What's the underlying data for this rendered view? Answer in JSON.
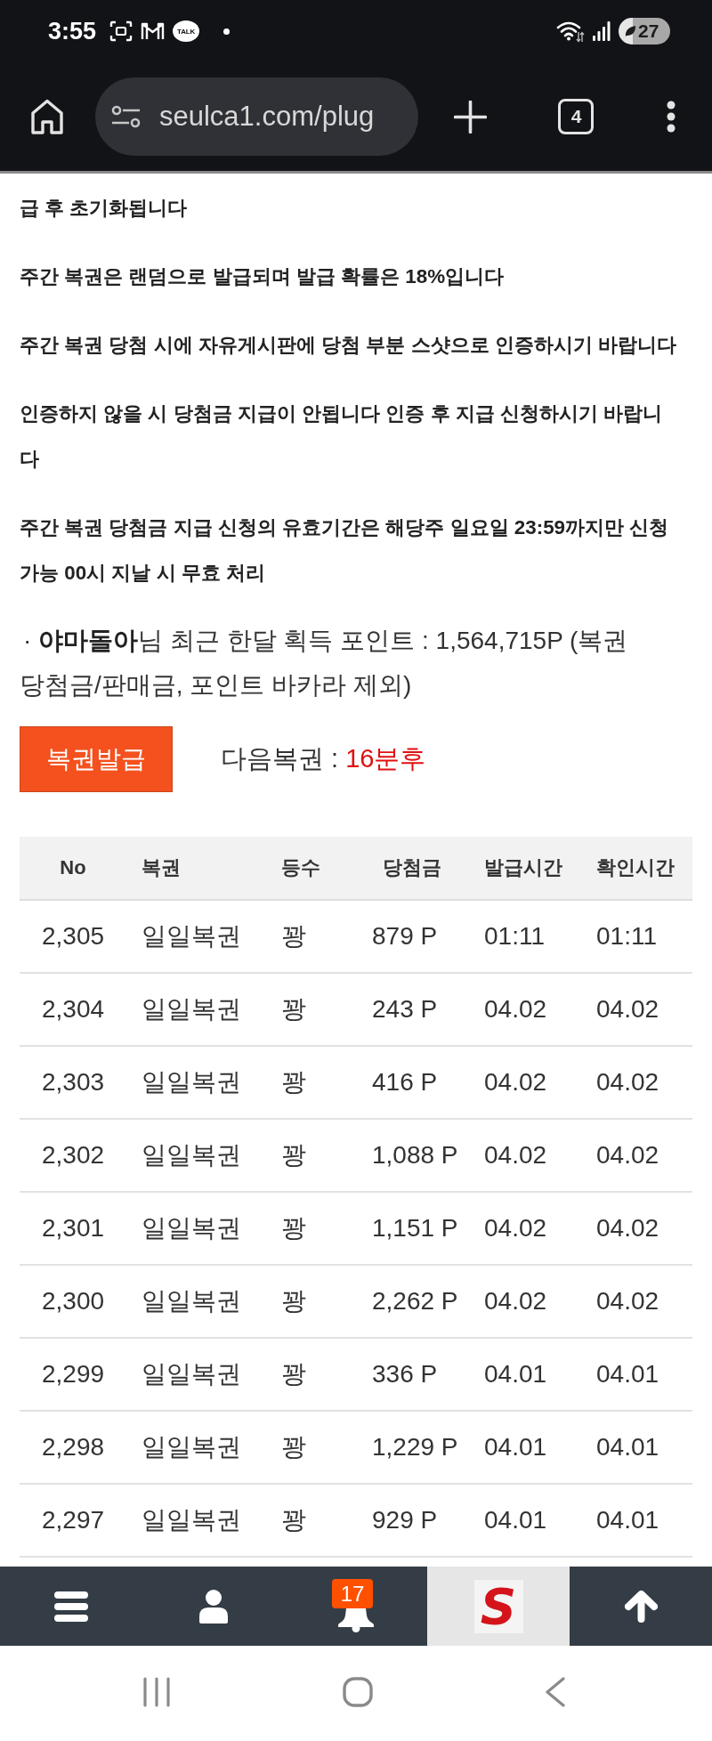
{
  "status_bar": {
    "time": "3:55",
    "chat_app_label": "TALK",
    "battery": "27"
  },
  "browser": {
    "url": "seulca1.com/plug",
    "tab_count": "4"
  },
  "notices": [
    "급 후 초기화됩니다",
    "주간 복권은 랜덤으로 발급되며 발급 확률은 18%입니다",
    "주간 복권 당첨 시에 자유게시판에 당첨 부분 스샷으로 인증하시기 바랍니다",
    "인증하지 않을 시 당첨금 지급이 안됩니다 인증 후 지급 신청하시기 바랍니다",
    "주간 복권 당첨금 지급 신청의 유효기간은 해당주 일요일 23:59까지만 신청 가능 00시 지날 시 무효 처리"
  ],
  "points_summary": "· **야마돌아**님 최근 한달 획득 포인트 : 1,564,715P (복권 당첨금/판매금, 포인트 바카라 제외)",
  "issue_button": "복권발급",
  "next_lottery": {
    "label": "다음복권 :",
    "value": "16분후"
  },
  "table": {
    "columns": [
      "No",
      "복권",
      "등수",
      "당첨금",
      "발급시간",
      "확인시간"
    ],
    "rows": [
      [
        "2,305",
        "일일복권",
        "꽝",
        "879 P",
        "01:11",
        "01:11"
      ],
      [
        "2,304",
        "일일복권",
        "꽝",
        "243 P",
        "04.02",
        "04.02"
      ],
      [
        "2,303",
        "일일복권",
        "꽝",
        "416 P",
        "04.02",
        "04.02"
      ],
      [
        "2,302",
        "일일복권",
        "꽝",
        "1,088 P",
        "04.02",
        "04.02"
      ],
      [
        "2,301",
        "일일복권",
        "꽝",
        "1,151 P",
        "04.02",
        "04.02"
      ],
      [
        "2,300",
        "일일복권",
        "꽝",
        "2,262 P",
        "04.02",
        "04.02"
      ],
      [
        "2,299",
        "일일복권",
        "꽝",
        "336 P",
        "04.01",
        "04.01"
      ],
      [
        "2,298",
        "일일복권",
        "꽝",
        "1,229 P",
        "04.01",
        "04.01"
      ],
      [
        "2,297",
        "일일복권",
        "꽝",
        "929 P",
        "04.01",
        "04.01"
      ]
    ]
  },
  "bottom_nav": [
    {
      "kind": "menu"
    },
    {
      "kind": "profile"
    },
    {
      "kind": "notifications",
      "badge": "17"
    },
    {
      "kind": "logo",
      "label": "S"
    },
    {
      "kind": "top"
    }
  ]
}
